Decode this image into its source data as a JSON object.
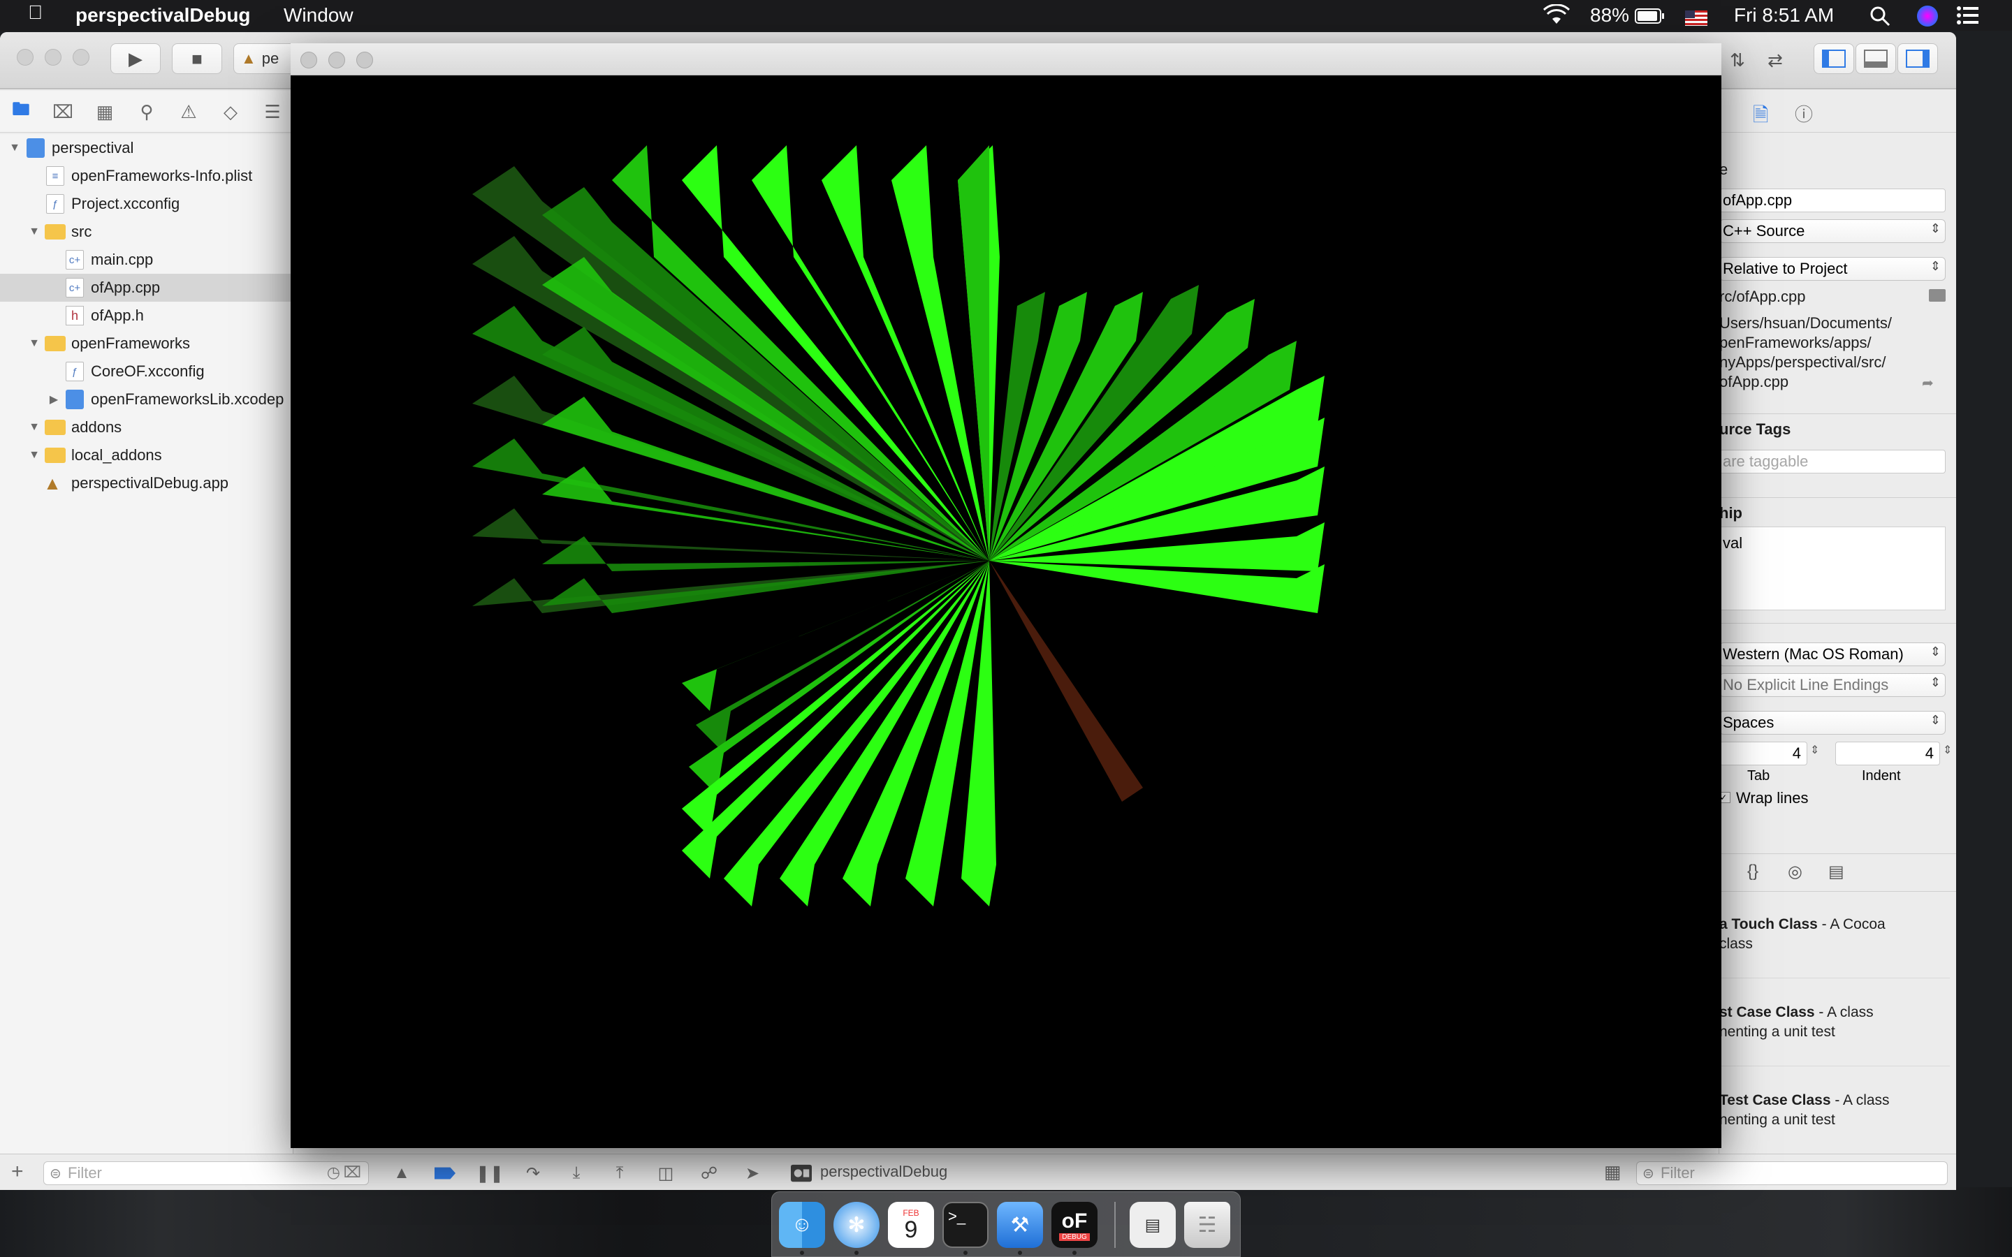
{
  "menubar": {
    "app_name": "perspectivalDebug",
    "menu_window": "Window",
    "battery": "88%",
    "clock": "Fri 8:51 AM"
  },
  "toolbar": {
    "scheme_label": "pe"
  },
  "navigator": {
    "items": [
      {
        "label": "perspectival"
      },
      {
        "label": "openFrameworks-Info.plist"
      },
      {
        "label": "Project.xcconfig"
      },
      {
        "label": "src"
      },
      {
        "label": "main.cpp"
      },
      {
        "label": "ofApp.cpp"
      },
      {
        "label": "ofApp.h"
      },
      {
        "label": "openFrameworks"
      },
      {
        "label": "CoreOF.xcconfig"
      },
      {
        "label": "openFrameworksLib.xcodep"
      },
      {
        "label": "addons"
      },
      {
        "label": "local_addons"
      },
      {
        "label": "perspectivalDebug.app"
      }
    ],
    "filter_placeholder": "Filter"
  },
  "debug_bar": {
    "process_label": "perspectivalDebug"
  },
  "inspector": {
    "name_header_fragment": "e",
    "file_name": "ofApp.cpp",
    "file_type": "C++ Source",
    "location": "Relative to Project",
    "relative_path": "rc/ofApp.cpp",
    "full_path_lines": [
      "Users/hsuan/Documents/",
      "penFrameworks/apps/",
      "nyApps/perspectival/src/",
      "ofApp.cpp"
    ],
    "source_tags_header": "urce Tags",
    "tags_placeholder": "are taggable",
    "membership_header": "hip",
    "membership_value": "val",
    "text_encoding": "Western (Mac OS Roman)",
    "line_endings": "No Explicit Line Endings",
    "indent_using": "Spaces",
    "tab_value": "4",
    "indent_value": "4",
    "tab_label": "Tab",
    "indent_label": "Indent",
    "wrap_lines": "Wrap lines",
    "library": [
      {
        "title": "a Touch Class",
        "desc1": " - A Cocoa",
        "desc2": "class"
      },
      {
        "title": "st Case Class",
        "desc1": " - A class",
        "desc2": "nenting a unit test"
      },
      {
        "title": "Test Case Class",
        "desc1": " - A class",
        "desc2": "nenting a unit test"
      }
    ],
    "filter_placeholder": "Filter"
  },
  "visualization": {
    "colors": {
      "bright": "#2cff12",
      "mid": "#1fc20d",
      "dark": "#178a0b",
      "darkest": "#1c5612",
      "brown": "#4a1c0c"
    }
  },
  "dock": {
    "calendar_month": "FEB",
    "calendar_day": "9",
    "of_badge": "DEBUG"
  },
  "icons": {
    "apple": "apple-icon",
    "wifi": "wifi-icon",
    "battery": "battery-icon",
    "flag": "flag-icon",
    "search": "spotlight-icon",
    "siri": "siri-icon",
    "notifications": "notification-center-icon"
  }
}
